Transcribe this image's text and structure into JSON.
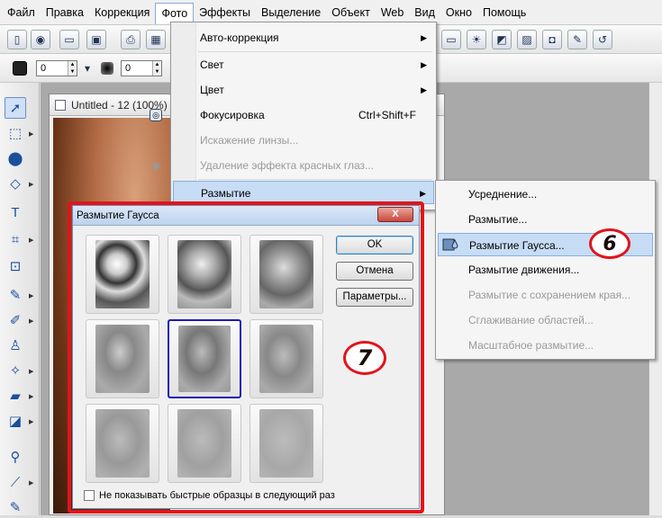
{
  "menubar": {
    "items": [
      {
        "label": "Файл"
      },
      {
        "label": "Правка"
      },
      {
        "label": "Коррекция"
      },
      {
        "label": "Фото"
      },
      {
        "label": "Эффекты"
      },
      {
        "label": "Выделение"
      },
      {
        "label": "Объект"
      },
      {
        "label": "Web"
      },
      {
        "label": "Вид"
      },
      {
        "label": "Окно"
      },
      {
        "label": "Помощь"
      }
    ],
    "active": "Фото"
  },
  "toolbar2": {
    "field1_value": "0",
    "field2_value": "0"
  },
  "document": {
    "title": "Untitled - 12 (100%)"
  },
  "photo_menu": {
    "items": [
      {
        "label": "Авто-коррекция",
        "submenu": true
      },
      {
        "label": "Свет",
        "submenu": true
      },
      {
        "label": "Цвет",
        "submenu": true
      },
      {
        "label": "Фокусировка",
        "shortcut": "Ctrl+Shift+F"
      },
      {
        "label": "Искажение линзы...",
        "disabled": true
      },
      {
        "label": "Удаление эффекта красных глаз...",
        "disabled": true
      },
      {
        "label": "Размытие",
        "submenu": true,
        "highlighted": true
      }
    ]
  },
  "blur_submenu": {
    "items": [
      {
        "label": "Усреднение..."
      },
      {
        "label": "Размытие..."
      },
      {
        "label": "Размытие Гаусса...",
        "highlighted": true
      },
      {
        "label": "Размытие движения..."
      },
      {
        "label": "Размытие с сохранением края...",
        "disabled": true
      },
      {
        "label": "Сглаживание областей...",
        "disabled": true
      },
      {
        "label": "Масштабное размытие...",
        "disabled": true
      }
    ]
  },
  "dialog": {
    "title": "Размытие Гаусса",
    "close_label": "X",
    "ok_label": "OK",
    "cancel_label": "Отмена",
    "params_label": "Параметры...",
    "checkbox_label": "Не показывать быстрые образцы в следующий раз",
    "selected_thumb_index": 4
  },
  "callouts": {
    "step6": "6",
    "step7": "7"
  },
  "colors": {
    "highlight_red": "#e2141b",
    "menu_highlight": "#c7dcf5",
    "selection_border": "#1b1bb5"
  }
}
